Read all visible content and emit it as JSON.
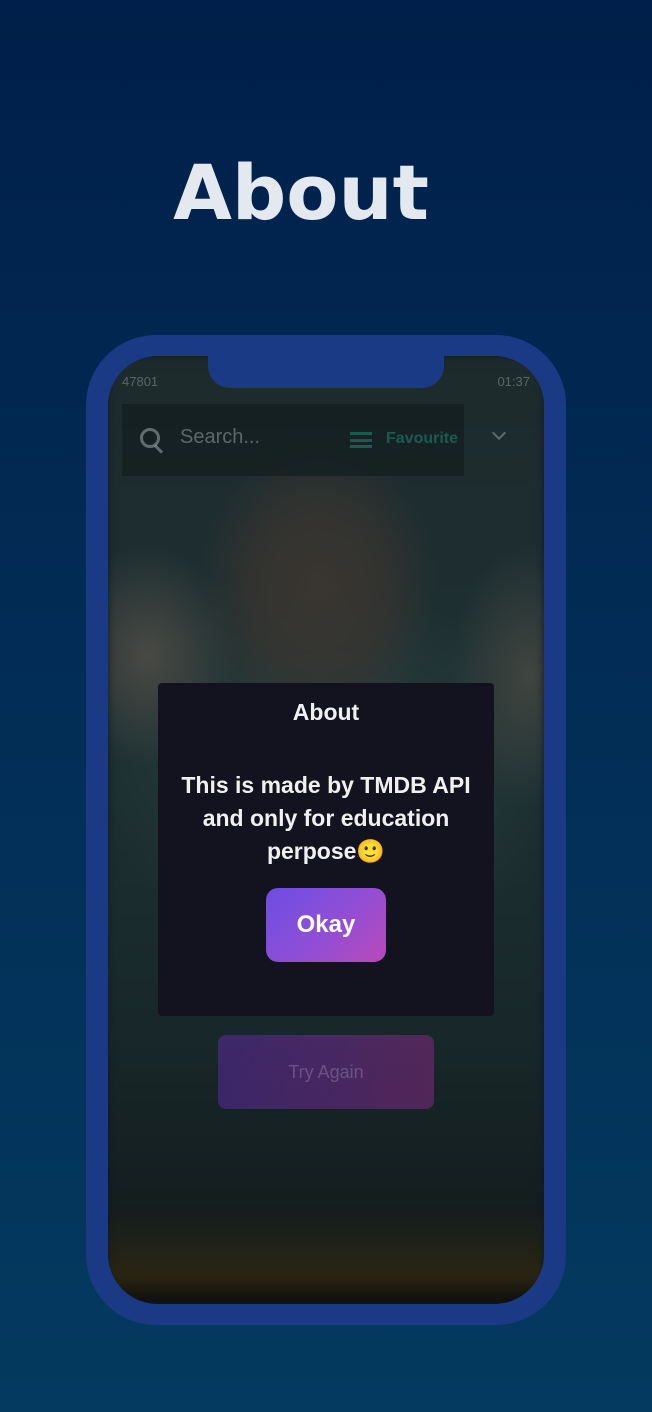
{
  "page_title": "About",
  "phone": {
    "status_left": "47801",
    "status_right": "01:37",
    "search": {
      "placeholder": "Search...",
      "favourite_label": "Favourite"
    },
    "dialog": {
      "title": "About",
      "message": "This is made by TMDB API and only for education perpose🙂",
      "okay_label": "Okay"
    },
    "try_again_label": "Try Again"
  },
  "colors": {
    "background_top": "#001f4a",
    "background_bottom": "#043a5f",
    "phone_frame": "#1a3a86",
    "dialog_bg": "#13121f",
    "button_gradient_start": "#6c4ee2",
    "button_gradient_end": "#b84ab8"
  }
}
